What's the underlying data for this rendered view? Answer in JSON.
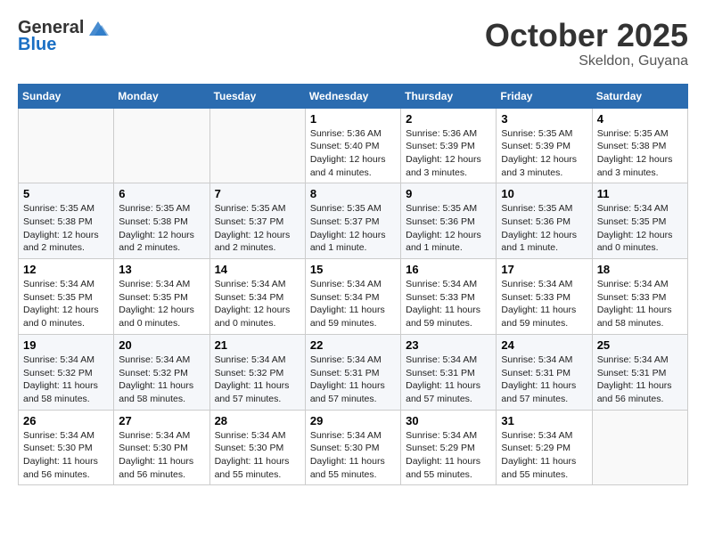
{
  "header": {
    "logo_general": "General",
    "logo_blue": "Blue",
    "month_title": "October 2025",
    "location": "Skeldon, Guyana"
  },
  "calendar": {
    "weekdays": [
      "Sunday",
      "Monday",
      "Tuesday",
      "Wednesday",
      "Thursday",
      "Friday",
      "Saturday"
    ],
    "weeks": [
      [
        {
          "day": "",
          "info": ""
        },
        {
          "day": "",
          "info": ""
        },
        {
          "day": "",
          "info": ""
        },
        {
          "day": "1",
          "info": "Sunrise: 5:36 AM\nSunset: 5:40 PM\nDaylight: 12 hours\nand 4 minutes."
        },
        {
          "day": "2",
          "info": "Sunrise: 5:36 AM\nSunset: 5:39 PM\nDaylight: 12 hours\nand 3 minutes."
        },
        {
          "day": "3",
          "info": "Sunrise: 5:35 AM\nSunset: 5:39 PM\nDaylight: 12 hours\nand 3 minutes."
        },
        {
          "day": "4",
          "info": "Sunrise: 5:35 AM\nSunset: 5:38 PM\nDaylight: 12 hours\nand 3 minutes."
        }
      ],
      [
        {
          "day": "5",
          "info": "Sunrise: 5:35 AM\nSunset: 5:38 PM\nDaylight: 12 hours\nand 2 minutes."
        },
        {
          "day": "6",
          "info": "Sunrise: 5:35 AM\nSunset: 5:38 PM\nDaylight: 12 hours\nand 2 minutes."
        },
        {
          "day": "7",
          "info": "Sunrise: 5:35 AM\nSunset: 5:37 PM\nDaylight: 12 hours\nand 2 minutes."
        },
        {
          "day": "8",
          "info": "Sunrise: 5:35 AM\nSunset: 5:37 PM\nDaylight: 12 hours\nand 1 minute."
        },
        {
          "day": "9",
          "info": "Sunrise: 5:35 AM\nSunset: 5:36 PM\nDaylight: 12 hours\nand 1 minute."
        },
        {
          "day": "10",
          "info": "Sunrise: 5:35 AM\nSunset: 5:36 PM\nDaylight: 12 hours\nand 1 minute."
        },
        {
          "day": "11",
          "info": "Sunrise: 5:34 AM\nSunset: 5:35 PM\nDaylight: 12 hours\nand 0 minutes."
        }
      ],
      [
        {
          "day": "12",
          "info": "Sunrise: 5:34 AM\nSunset: 5:35 PM\nDaylight: 12 hours\nand 0 minutes."
        },
        {
          "day": "13",
          "info": "Sunrise: 5:34 AM\nSunset: 5:35 PM\nDaylight: 12 hours\nand 0 minutes."
        },
        {
          "day": "14",
          "info": "Sunrise: 5:34 AM\nSunset: 5:34 PM\nDaylight: 12 hours\nand 0 minutes."
        },
        {
          "day": "15",
          "info": "Sunrise: 5:34 AM\nSunset: 5:34 PM\nDaylight: 11 hours\nand 59 minutes."
        },
        {
          "day": "16",
          "info": "Sunrise: 5:34 AM\nSunset: 5:33 PM\nDaylight: 11 hours\nand 59 minutes."
        },
        {
          "day": "17",
          "info": "Sunrise: 5:34 AM\nSunset: 5:33 PM\nDaylight: 11 hours\nand 59 minutes."
        },
        {
          "day": "18",
          "info": "Sunrise: 5:34 AM\nSunset: 5:33 PM\nDaylight: 11 hours\nand 58 minutes."
        }
      ],
      [
        {
          "day": "19",
          "info": "Sunrise: 5:34 AM\nSunset: 5:32 PM\nDaylight: 11 hours\nand 58 minutes."
        },
        {
          "day": "20",
          "info": "Sunrise: 5:34 AM\nSunset: 5:32 PM\nDaylight: 11 hours\nand 58 minutes."
        },
        {
          "day": "21",
          "info": "Sunrise: 5:34 AM\nSunset: 5:32 PM\nDaylight: 11 hours\nand 57 minutes."
        },
        {
          "day": "22",
          "info": "Sunrise: 5:34 AM\nSunset: 5:31 PM\nDaylight: 11 hours\nand 57 minutes."
        },
        {
          "day": "23",
          "info": "Sunrise: 5:34 AM\nSunset: 5:31 PM\nDaylight: 11 hours\nand 57 minutes."
        },
        {
          "day": "24",
          "info": "Sunrise: 5:34 AM\nSunset: 5:31 PM\nDaylight: 11 hours\nand 57 minutes."
        },
        {
          "day": "25",
          "info": "Sunrise: 5:34 AM\nSunset: 5:31 PM\nDaylight: 11 hours\nand 56 minutes."
        }
      ],
      [
        {
          "day": "26",
          "info": "Sunrise: 5:34 AM\nSunset: 5:30 PM\nDaylight: 11 hours\nand 56 minutes."
        },
        {
          "day": "27",
          "info": "Sunrise: 5:34 AM\nSunset: 5:30 PM\nDaylight: 11 hours\nand 56 minutes."
        },
        {
          "day": "28",
          "info": "Sunrise: 5:34 AM\nSunset: 5:30 PM\nDaylight: 11 hours\nand 55 minutes."
        },
        {
          "day": "29",
          "info": "Sunrise: 5:34 AM\nSunset: 5:30 PM\nDaylight: 11 hours\nand 55 minutes."
        },
        {
          "day": "30",
          "info": "Sunrise: 5:34 AM\nSunset: 5:29 PM\nDaylight: 11 hours\nand 55 minutes."
        },
        {
          "day": "31",
          "info": "Sunrise: 5:34 AM\nSunset: 5:29 PM\nDaylight: 11 hours\nand 55 minutes."
        },
        {
          "day": "",
          "info": ""
        }
      ]
    ]
  }
}
